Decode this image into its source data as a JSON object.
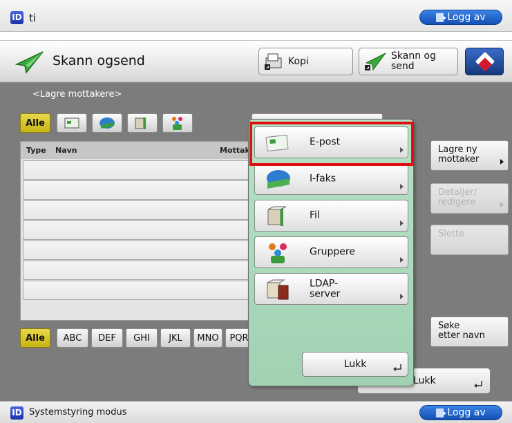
{
  "top_bar": {
    "user_id": "ID",
    "user_name": "ti",
    "logout": "Logg av"
  },
  "header": {
    "title": "Skann ogsend",
    "copy_button": "Kopi",
    "scan_send_button": "Skann og\nsend"
  },
  "main": {
    "subtitle": "<Lagre mottakere>",
    "filter_all": "Alle",
    "filter_icons": [
      "email-icon",
      "ifax-icon",
      "file-icon",
      "group-icon"
    ],
    "columns": [
      "Type",
      "Navn",
      "Mottak"
    ],
    "alpha_tabs": [
      "Alle",
      "ABC",
      "DEF",
      "GHI",
      "JKL",
      "MNO",
      "PQR"
    ],
    "side_buttons": {
      "save_new": "Lagre ny\nmottaker",
      "details": "Detaljer/\nredigere",
      "delete": "Slette",
      "search": "Søke\netter navn"
    },
    "close": "Lukk"
  },
  "popup": {
    "items": [
      {
        "label": "E-post",
        "icon": "email-icon"
      },
      {
        "label": "I-faks",
        "icon": "ifax-icon"
      },
      {
        "label": "Fil",
        "icon": "file-icon"
      },
      {
        "label": "Gruppere",
        "icon": "group-icon"
      },
      {
        "label": "LDAP-\nserver",
        "icon": "ldap-server-icon"
      }
    ],
    "close": "Lukk"
  },
  "bottom_bar": {
    "user_id": "ID",
    "label": "Systemstyring modus",
    "logout": "Logg av"
  },
  "colors": {
    "accent_yellow": "#d8c628",
    "popup_bg": "#aadbbb",
    "highlight": "#e01010",
    "logout_blue": "#2466c8"
  }
}
